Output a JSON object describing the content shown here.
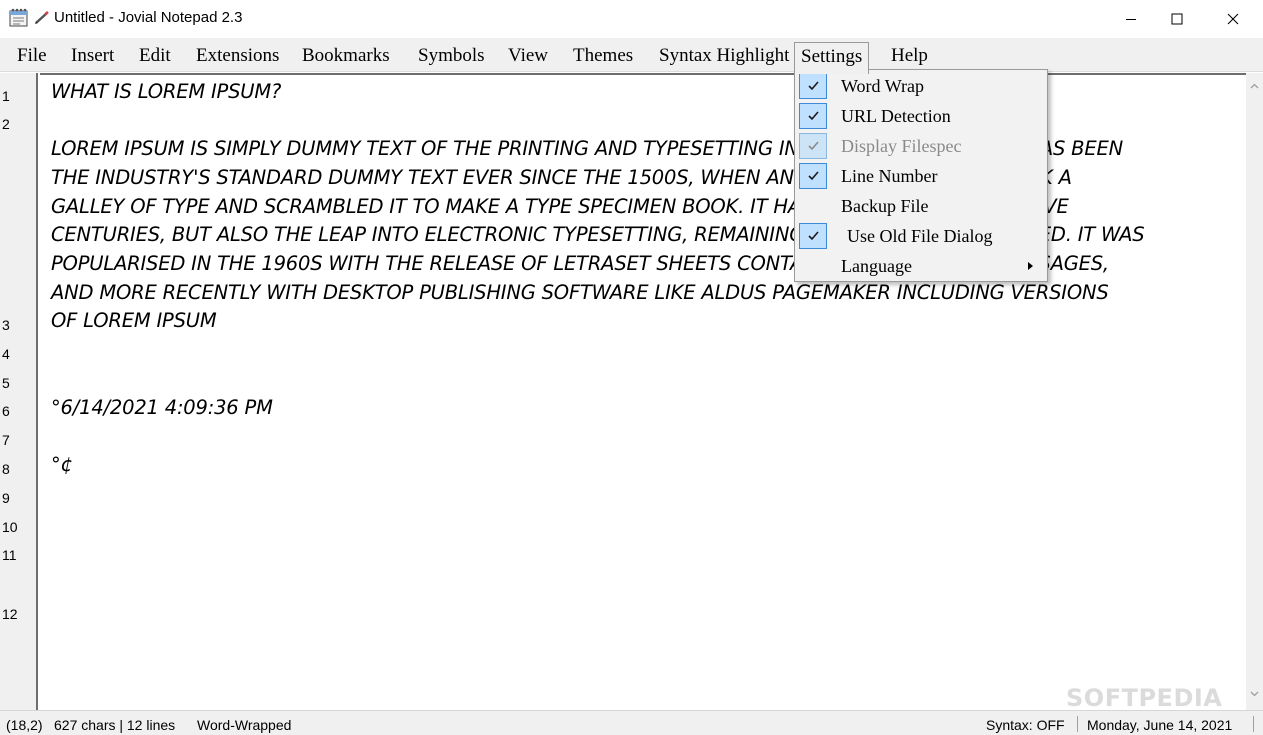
{
  "window": {
    "title": "Untitled - Jovial Notepad 2.3"
  },
  "menubar": {
    "items": [
      "File",
      "Insert",
      "Edit",
      "Extensions",
      "Bookmarks",
      "Symbols",
      "View",
      "Themes",
      "Syntax Highlight",
      "Settings",
      "Help"
    ]
  },
  "settings_menu": {
    "items": [
      {
        "label": "Word Wrap",
        "checked": true,
        "disabled": false
      },
      {
        "label": "URL Detection",
        "checked": true,
        "disabled": false
      },
      {
        "label": "Display Filespec",
        "checked": true,
        "disabled": true
      },
      {
        "label": "Line Number",
        "checked": true,
        "disabled": false
      },
      {
        "label": "Backup File",
        "checked": false,
        "disabled": false
      },
      {
        "label": "Use Old File Dialog",
        "checked": true,
        "disabled": false
      },
      {
        "label": "Language",
        "checked": false,
        "disabled": false,
        "submenu": true
      }
    ]
  },
  "gutter": {
    "numbers": [
      "1",
      "2",
      "3",
      "4",
      "5",
      "6",
      "7",
      "8",
      "9",
      "10",
      "11",
      "12"
    ]
  },
  "editor": {
    "lines": [
      "WHAT IS LOREM IPSUM?",
      "LOREM IPSUM IS SIMPLY DUMMY TEXT OF THE PRINTING AND TYPESETTING INDUSTRY. LOREM IPSUM HAS BEEN",
      "THE INDUSTRY'S STANDARD DUMMY TEXT EVER SINCE THE 1500S, WHEN AN UNKNOWN PRINTER TOOK A",
      "GALLEY OF TYPE AND SCRAMBLED IT TO MAKE A TYPE SPECIMEN BOOK. IT HAS SURVIVED NOT ONLY FIVE",
      "CENTURIES, BUT ALSO THE LEAP INTO ELECTRONIC TYPESETTING, REMAINING ESSENTIALLY UNCHANGED. IT WAS",
      "POPULARISED IN THE 1960S WITH THE RELEASE OF LETRASET SHEETS CONTAINING LOREM IPSUM PASSAGES,",
      "AND MORE RECENTLY WITH DESKTOP PUBLISHING SOFTWARE LIKE ALDUS PAGEMAKER INCLUDING VERSIONS",
      "OF LOREM IPSUM",
      "°6/14/2021 4:09:36 PM",
      "°¢"
    ]
  },
  "statusbar": {
    "position": "(18,2)",
    "stats": "627 chars | 12 lines",
    "wrap": "Word-Wrapped",
    "syntax": "Syntax: OFF",
    "date": "Monday, June 14, 2021"
  },
  "watermark": "SOFTPEDIA",
  "colors": {
    "check_bg": "#bfe0ff",
    "check_border": "#3d8bd6",
    "chrome": "#f0f0f0"
  }
}
